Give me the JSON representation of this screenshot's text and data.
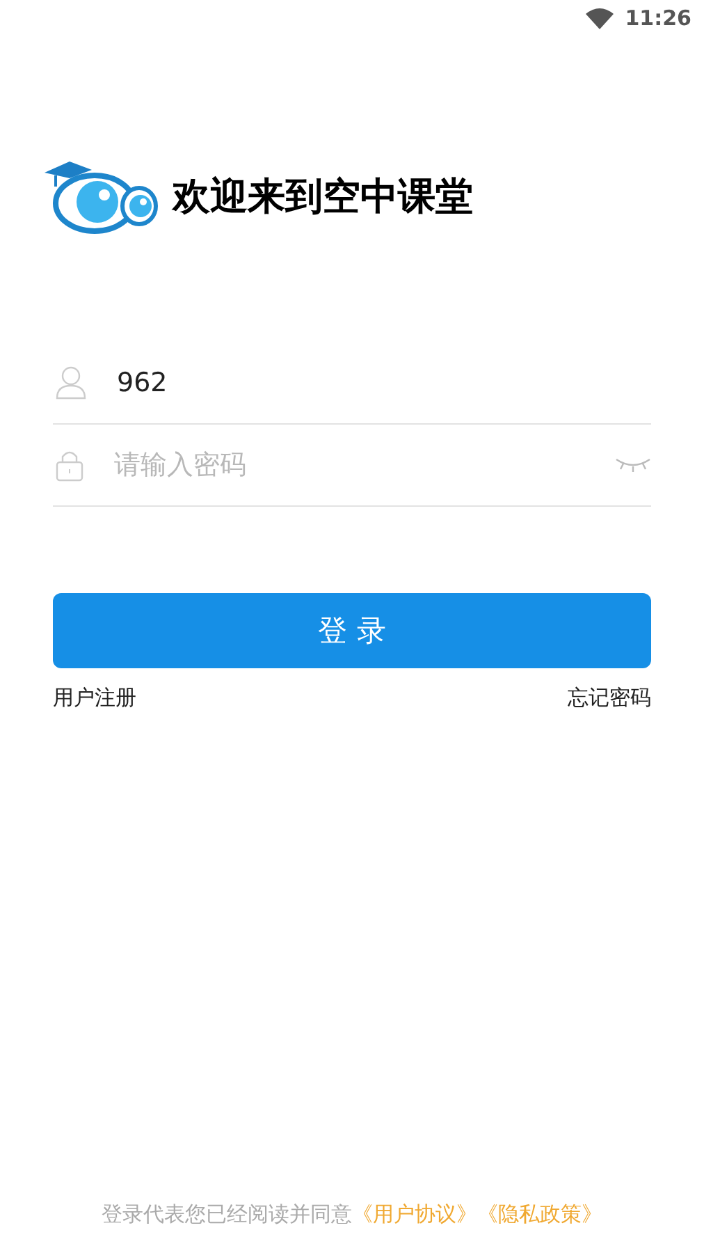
{
  "status_bar": {
    "time": "11:26"
  },
  "header": {
    "title": "欢迎来到空中课堂"
  },
  "username": {
    "value": "962"
  },
  "password": {
    "placeholder": "请输入密码",
    "visible": false
  },
  "login_button": "登 录",
  "links": [
    "用户注册",
    "忘记密码"
  ],
  "agreement": {
    "text": "登录代表您已经阅读并同意",
    "links": [
      "《用户协议》",
      "《隐私政策》"
    ]
  }
}
